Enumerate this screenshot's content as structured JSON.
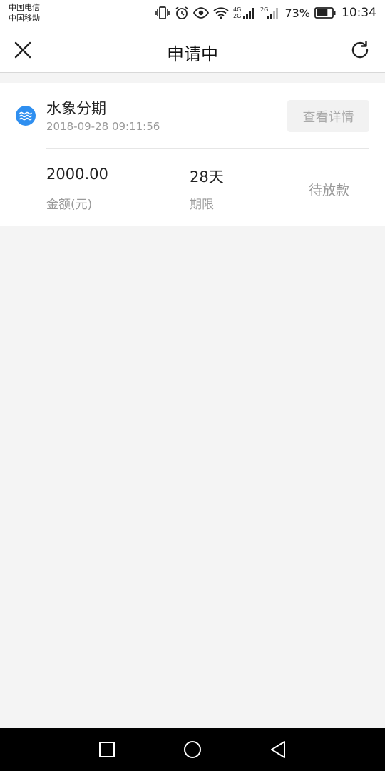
{
  "status_bar": {
    "carrier_1": "中国电信",
    "carrier_2": "中国移动",
    "network_1": "4G",
    "network_2": "2G",
    "network_3": "2G",
    "battery": "73%",
    "battery_level": 0.73,
    "time": "10:34"
  },
  "header": {
    "title": "申请中"
  },
  "application": {
    "product_name": "水象分期",
    "apply_time": "2018-09-28 09:11:56",
    "detail_button": "查看详情",
    "amount": "2000.00",
    "amount_label": "金额(元)",
    "term": "28天",
    "term_label": "期限",
    "status": "待放款"
  },
  "colors": {
    "brand_icon": "#2f8ff0",
    "background": "#f4f4f4"
  }
}
